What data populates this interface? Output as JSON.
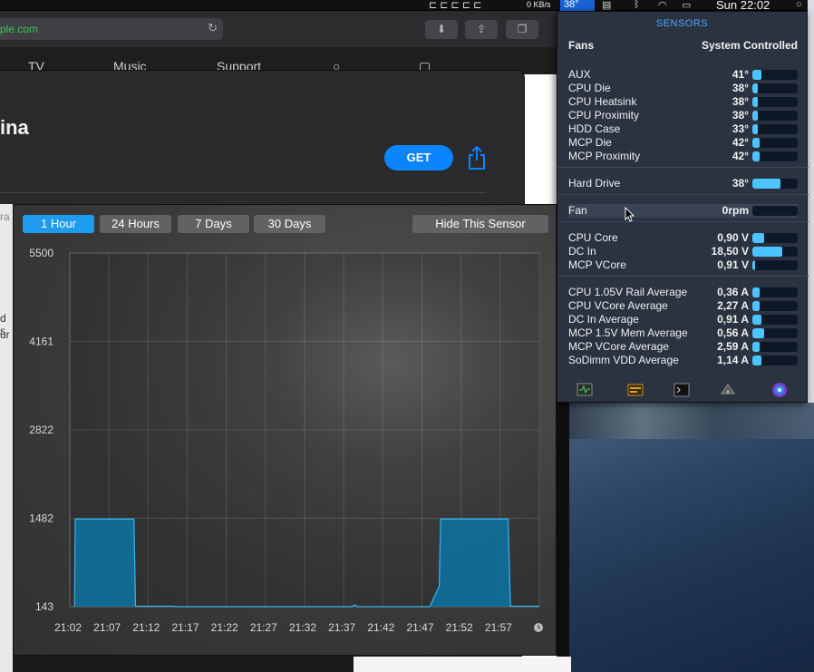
{
  "menubar": {
    "net_speed": "0 KB/s",
    "temp_indicator": "38°",
    "clock": "Sun 22:02"
  },
  "safari": {
    "address": "ple.com",
    "nav": [
      "TV",
      "Music",
      "Support"
    ]
  },
  "store": {
    "title_fragment": "ina",
    "get_label": "GET"
  },
  "behind_fragments": [
    "ra",
    "d s",
    "ur"
  ],
  "sensors": {
    "header": "SENSORS",
    "fans_label": "Fans",
    "fans_value": "System Controlled",
    "groups": [
      [
        {
          "label": "AUX",
          "value": "41°",
          "level": 0.2
        },
        {
          "label": "CPU Die",
          "value": "38°",
          "level": 0.12
        },
        {
          "label": "CPU Heatsink",
          "value": "38°",
          "level": 0.12
        },
        {
          "label": "CPU Proximity",
          "value": "38°",
          "level": 0.12
        },
        {
          "label": "HDD Case",
          "value": "33°",
          "level": 0.12
        },
        {
          "label": "MCP Die",
          "value": "42°",
          "level": 0.15
        },
        {
          "label": "MCP Proximity",
          "value": "42°",
          "level": 0.15
        }
      ],
      [
        {
          "label": "Hard Drive",
          "value": "38°",
          "level": 0.62
        }
      ],
      [
        {
          "label": "Fan",
          "value": "0rpm",
          "level": 0,
          "highlight": true
        }
      ],
      [
        {
          "label": "CPU Core",
          "value": "0,90 V",
          "level": 0.25
        },
        {
          "label": "DC In",
          "value": "18,50 V",
          "level": 0.65
        },
        {
          "label": "MCP VCore",
          "value": "0,91 V",
          "level": 0.05
        }
      ],
      [
        {
          "label": "CPU 1.05V Rail Average",
          "value": "0,36 A",
          "level": 0.15
        },
        {
          "label": "CPU VCore Average",
          "value": "2,27 A",
          "level": 0.15
        },
        {
          "label": "DC In Average",
          "value": "0,91 A",
          "level": 0.2
        },
        {
          "label": "MCP 1.5V Mem Average",
          "value": "0,56 A",
          "level": 0.25
        },
        {
          "label": "MCP VCore Average",
          "value": "2,59 A",
          "level": 0.15
        },
        {
          "label": "SoDimm VDD Average",
          "value": "1,14 A",
          "level": 0.2
        }
      ]
    ],
    "toolbar_icons": [
      "activity-monitor-icon",
      "hardware-report-icon",
      "terminal-icon",
      "network-icon",
      "color-picker-icon"
    ]
  },
  "history": {
    "ranges": [
      {
        "label": "1 Hour",
        "active": true
      },
      {
        "label": "24 Hours",
        "active": false
      },
      {
        "label": "7 Days",
        "active": false
      },
      {
        "label": "30 Days",
        "active": false
      }
    ],
    "hide_label": "Hide This Sensor",
    "accent": "#1f9bf0",
    "fill_color": "#0f6e98"
  },
  "chart_data": {
    "type": "area",
    "y_ticks": [
      "5500",
      "4161",
      "2822",
      "1482",
      "143"
    ],
    "x_ticks": [
      "21:02",
      "21:07",
      "21:12",
      "21:17",
      "21:22",
      "21:27",
      "21:32",
      "21:37",
      "21:42",
      "21:47",
      "21:52",
      "21:57"
    ],
    "ylim": [
      143,
      5500
    ],
    "xlim_minutes": [
      0,
      60
    ],
    "grid": true,
    "series": [
      {
        "x_minutes": [
          0.6,
          0.7,
          8.2,
          8.4,
          13.3,
          13.5,
          16.8,
          17.0,
          36.0,
          36.4,
          36.8,
          46.0,
          47.2,
          47.4,
          56.0,
          56.3,
          60.0
        ],
        "y": [
          143,
          1470,
          1470,
          150,
          150,
          0,
          0,
          143,
          143,
          170,
          143,
          143,
          450,
          1470,
          1470,
          150,
          150
        ]
      }
    ]
  }
}
